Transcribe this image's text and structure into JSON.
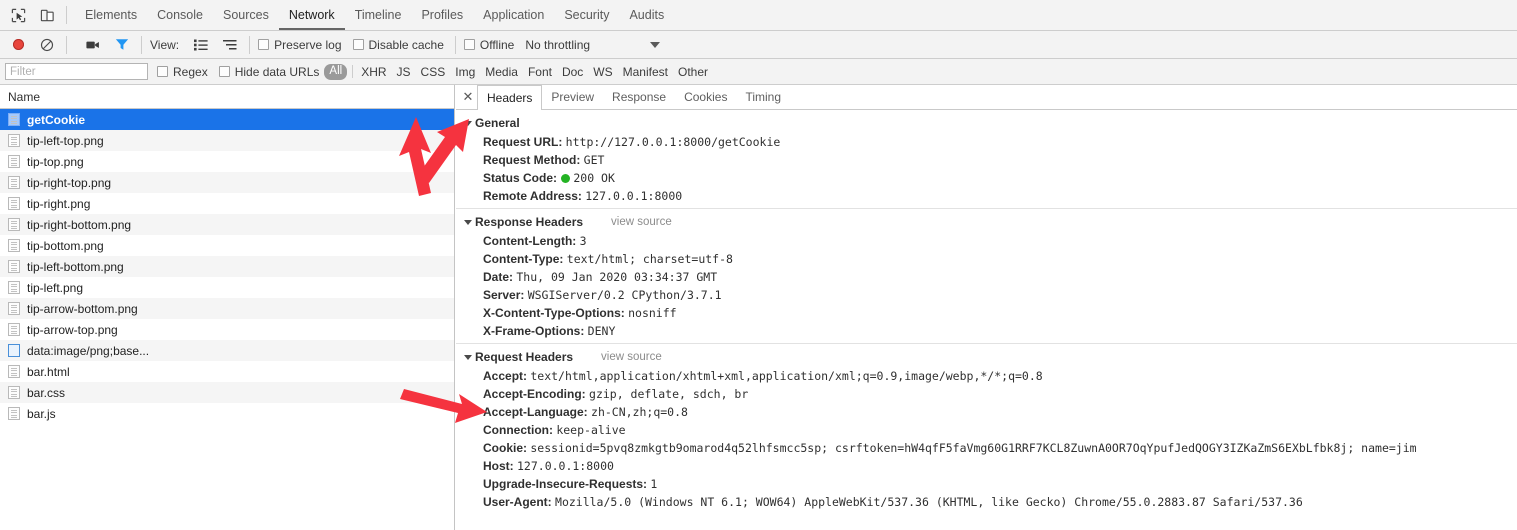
{
  "window": {
    "inspect_icon": "inspect-element-icon",
    "device_icon": "device-toolbar-icon"
  },
  "devtools_tabs": [
    {
      "label": "Elements",
      "active": false
    },
    {
      "label": "Console",
      "active": false
    },
    {
      "label": "Sources",
      "active": false
    },
    {
      "label": "Network",
      "active": true
    },
    {
      "label": "Timeline",
      "active": false
    },
    {
      "label": "Profiles",
      "active": false
    },
    {
      "label": "Application",
      "active": false
    },
    {
      "label": "Security",
      "active": false
    },
    {
      "label": "Audits",
      "active": false
    }
  ],
  "control_bar": {
    "record_icon": "record-button-icon",
    "clear_icon": "clear-button-icon",
    "capture_screenshots_icon": "camera-icon",
    "filter_icon": "funnel-filter-icon",
    "view_label": "View:",
    "list_view_icon": "list-view-icon",
    "waterfall_view_icon": "waterfall-view-icon",
    "preserve_log": {
      "label": "Preserve log",
      "checked": false
    },
    "disable_cache": {
      "label": "Disable cache",
      "checked": false
    },
    "offline": {
      "label": "Offline",
      "checked": false
    },
    "throttling_value": "No throttling",
    "throttling_caret_icon": "chevron-down-icon"
  },
  "filter_bar": {
    "filter_placeholder": "Filter",
    "filter_value": "",
    "regex": {
      "label": "Regex",
      "checked": false
    },
    "hide_data_urls": {
      "label": "Hide data URLs",
      "checked": false
    },
    "types": [
      {
        "label": "All",
        "active": true
      },
      {
        "label": "XHR",
        "active": false
      },
      {
        "label": "JS",
        "active": false
      },
      {
        "label": "CSS",
        "active": false
      },
      {
        "label": "Img",
        "active": false
      },
      {
        "label": "Media",
        "active": false
      },
      {
        "label": "Font",
        "active": false
      },
      {
        "label": "Doc",
        "active": false
      },
      {
        "label": "WS",
        "active": false
      },
      {
        "label": "Manifest",
        "active": false
      },
      {
        "label": "Other",
        "active": false
      }
    ]
  },
  "request_list": {
    "column_header": "Name",
    "rows": [
      {
        "name": "getCookie",
        "icon": "document-icon",
        "selected": true
      },
      {
        "name": "tip-left-top.png",
        "icon": "image-icon",
        "selected": false
      },
      {
        "name": "tip-top.png",
        "icon": "image-icon",
        "selected": false
      },
      {
        "name": "tip-right-top.png",
        "icon": "image-icon",
        "selected": false
      },
      {
        "name": "tip-right.png",
        "icon": "image-icon",
        "selected": false
      },
      {
        "name": "tip-right-bottom.png",
        "icon": "image-icon",
        "selected": false
      },
      {
        "name": "tip-bottom.png",
        "icon": "image-icon",
        "selected": false
      },
      {
        "name": "tip-left-bottom.png",
        "icon": "image-icon",
        "selected": false
      },
      {
        "name": "tip-left.png",
        "icon": "image-icon",
        "selected": false
      },
      {
        "name": "tip-arrow-bottom.png",
        "icon": "image-icon",
        "selected": false
      },
      {
        "name": "tip-arrow-top.png",
        "icon": "image-icon",
        "selected": false
      },
      {
        "name": "data:image/png;base...",
        "icon": "data-url-icon",
        "selected": false
      },
      {
        "name": "bar.html",
        "icon": "document-icon",
        "selected": false
      },
      {
        "name": "bar.css",
        "icon": "stylesheet-icon",
        "selected": false
      },
      {
        "name": "bar.js",
        "icon": "script-icon",
        "selected": false
      }
    ]
  },
  "detail_panel": {
    "close_icon": "close-icon",
    "tabs": [
      {
        "label": "Headers",
        "active": true
      },
      {
        "label": "Preview",
        "active": false
      },
      {
        "label": "Response",
        "active": false
      },
      {
        "label": "Cookies",
        "active": false
      },
      {
        "label": "Timing",
        "active": false
      }
    ],
    "sections": [
      {
        "title": "General",
        "view_source": "",
        "rows": [
          {
            "key": "Request URL:",
            "value": "http://127.0.0.1:8000/getCookie"
          },
          {
            "key": "Request Method:",
            "value": "GET"
          },
          {
            "key": "Status Code:",
            "value": "200 OK",
            "status_dot": "#24b324"
          },
          {
            "key": "Remote Address:",
            "value": "127.0.0.1:8000"
          }
        ]
      },
      {
        "title": "Response Headers",
        "view_source": "view source",
        "rows": [
          {
            "key": "Content-Length:",
            "value": "3"
          },
          {
            "key": "Content-Type:",
            "value": "text/html; charset=utf-8"
          },
          {
            "key": "Date:",
            "value": "Thu, 09 Jan 2020 03:34:37 GMT"
          },
          {
            "key": "Server:",
            "value": "WSGIServer/0.2 CPython/3.7.1"
          },
          {
            "key": "X-Content-Type-Options:",
            "value": "nosniff"
          },
          {
            "key": "X-Frame-Options:",
            "value": "DENY"
          }
        ]
      },
      {
        "title": "Request Headers",
        "view_source": "view source",
        "rows": [
          {
            "key": "Accept:",
            "value": "text/html,application/xhtml+xml,application/xml;q=0.9,image/webp,*/*;q=0.8"
          },
          {
            "key": "Accept-Encoding:",
            "value": "gzip, deflate, sdch, br"
          },
          {
            "key": "Accept-Language:",
            "value": "zh-CN,zh;q=0.8"
          },
          {
            "key": "Connection:",
            "value": "keep-alive"
          },
          {
            "key": "Cookie:",
            "value": "sessionid=5pvq8zmkgtb9omarod4q52lhfsmcc5sp; csrftoken=hW4qfF5faVmg60G1RRF7KCL8ZuwnA0OR7OqYpufJedQOGY3IZKaZmS6EXbLfbk8j; name=jim"
          },
          {
            "key": "Host:",
            "value": "127.0.0.1:8000"
          },
          {
            "key": "Upgrade-Insecure-Requests:",
            "value": "1"
          },
          {
            "key": "User-Agent:",
            "value": "Mozilla/5.0 (Windows NT 6.1; WOW64) AppleWebKit/537.36 (KHTML, like Gecko) Chrome/55.0.2883.87 Safari/537.36"
          }
        ]
      }
    ]
  },
  "annotations": {
    "arrow_color": "#f5333f",
    "arrows": [
      {
        "name": "arrow-to-selected-request"
      },
      {
        "name": "arrow-to-general-section"
      },
      {
        "name": "arrow-to-cookie-header"
      }
    ]
  }
}
